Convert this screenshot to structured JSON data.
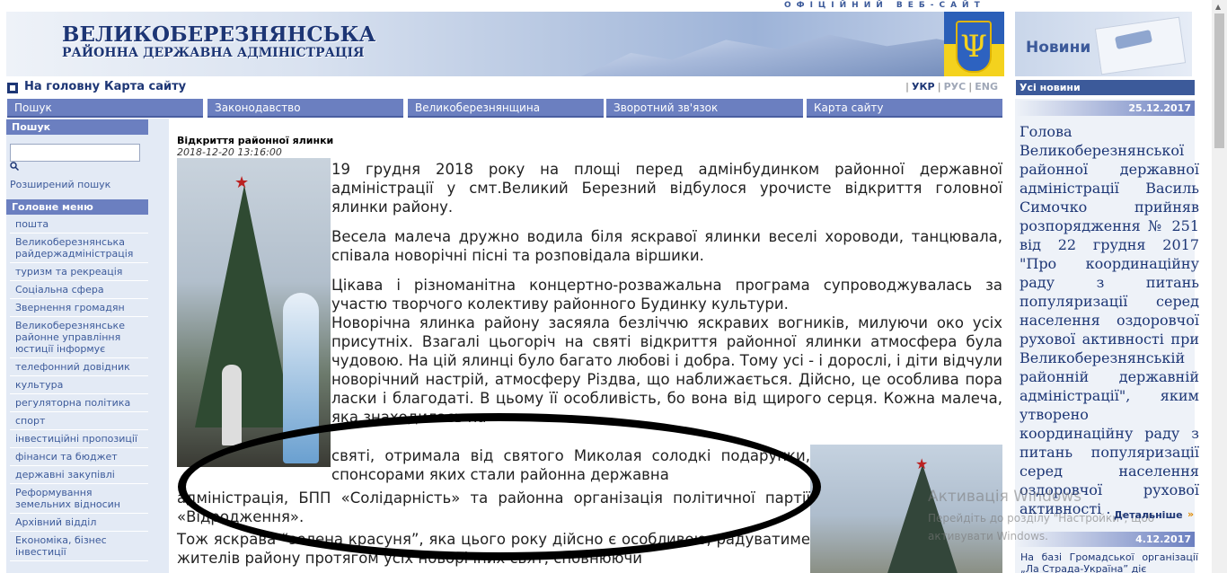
{
  "header": {
    "official": "ОФІЦІЙНИЙ ВЕБ-САЙТ",
    "title_line1": "ВЕЛИКОБЕРЕЗНЯНСЬКА",
    "title_line2": "РАЙОННА ДЕРЖАВНА АДМІНІСТРАЦІЯ",
    "news_box_label": "Новини",
    "trident_glyph": "Ψ"
  },
  "toplinks": {
    "home": "На головну",
    "sitemap": "Карта сайту"
  },
  "languages": [
    {
      "label": "УКР",
      "color": "#1d3675"
    },
    {
      "label": "РУС",
      "color": "#a0a8b8"
    },
    {
      "label": "ENG",
      "color": "#a0a8b8"
    }
  ],
  "nav": [
    "Пошук",
    "Законодавство",
    "Великоберезнянщина",
    "Зворотний зв'язок",
    "Карта сайту"
  ],
  "sidebar": {
    "search_heading": "Пошук",
    "search_placeholder": "",
    "advanced_search": "Розширений пошук",
    "menu_heading": "Головне меню",
    "menu": [
      "пошта",
      "Великоберезнянська райдержадміністрація",
      "туризм та рекреація",
      "Соціальна сфера",
      "Звернення громадян",
      "Великоберезнянське районне управління юстиції інформує",
      "телефонний довідник",
      "культура",
      "регуляторна політика",
      "спорт",
      "інвестиційні пропозиції",
      "фінанси та бюджет",
      "державні закупівлі",
      "Реформування земельних відносин",
      "Архівний відділ",
      "Економіка, бізнес інвестиції"
    ]
  },
  "article": {
    "title": "Відкриття районної ялинки",
    "date": "2018-12-20 13:16:00",
    "p1": "19 грудня 2018 року на площі перед адмінбудинком  районної державної адміністрації у смт.Великий Березний відбулося урочисте відкриття головної ялинки району.",
    "p2": " Весела малеча дружно водила біля яскравої ялинки веселі хороводи, танцювала, співала новорічні пісні та розповідала віршики.",
    "p3": "Цікава і різноманітна концертно-розважальна програма супроводжувалась за участю творчого колективу районного Будинку культури.",
    "p4": "Новорічна ялинка району засяяла безліччю яскравих вогників, милуючи око усіх присутніх. Взагалі цьогоріч на святі відкриття районної ялинки атмосфера була чудовою. На цій ялинці було багато любові і добра. Тому усі - і дорослі, і діти відчули новорічний настрій, атмосферу Різдва, що наближається. Дійсно, це особлива пора ласки і благодаті. В цьому її особливість, бо вона від щирого серця. Кожна малеча, яка знаходилась на",
    "p4b": "святі, отримала від святого Миколая солодкі подарунки, спонсорами яких стали районна державна",
    "p4c": "адміністрація, БПП «Солідарність» та районна організація політичної партії «Відродження».",
    "p5": "Тож яскрава “зелена красуня”, яка цього року дійсно є особливою, радуватиме жителів району протягом усіх новорічних свят, сповнюючи"
  },
  "news": {
    "all_news": "Усі новини",
    "date1": "25.12.2017",
    "text1": "Голова Великоберезнянської районної державної адміністрації Василь Симочко прийняв розпорядження № 251 від 22 грудня 2017 \"Про координаційну раду з питань популяризації серед населення оздоровчої рухової активності при Великоберезнянській районній державній адміністрації\", яким утворено координаційну раду з питань популяризації серед населення оздоровчої рухової активності .",
    "more": "Детальніше",
    "date2": "4.12.2017",
    "text2": "На базі Громадської організації „Ла Страда-Україна” діє"
  },
  "watermark": {
    "line1": "Активація Windows",
    "line2": "Перейдіть до розділу \"Настройки\", щоб активувати Windows."
  }
}
